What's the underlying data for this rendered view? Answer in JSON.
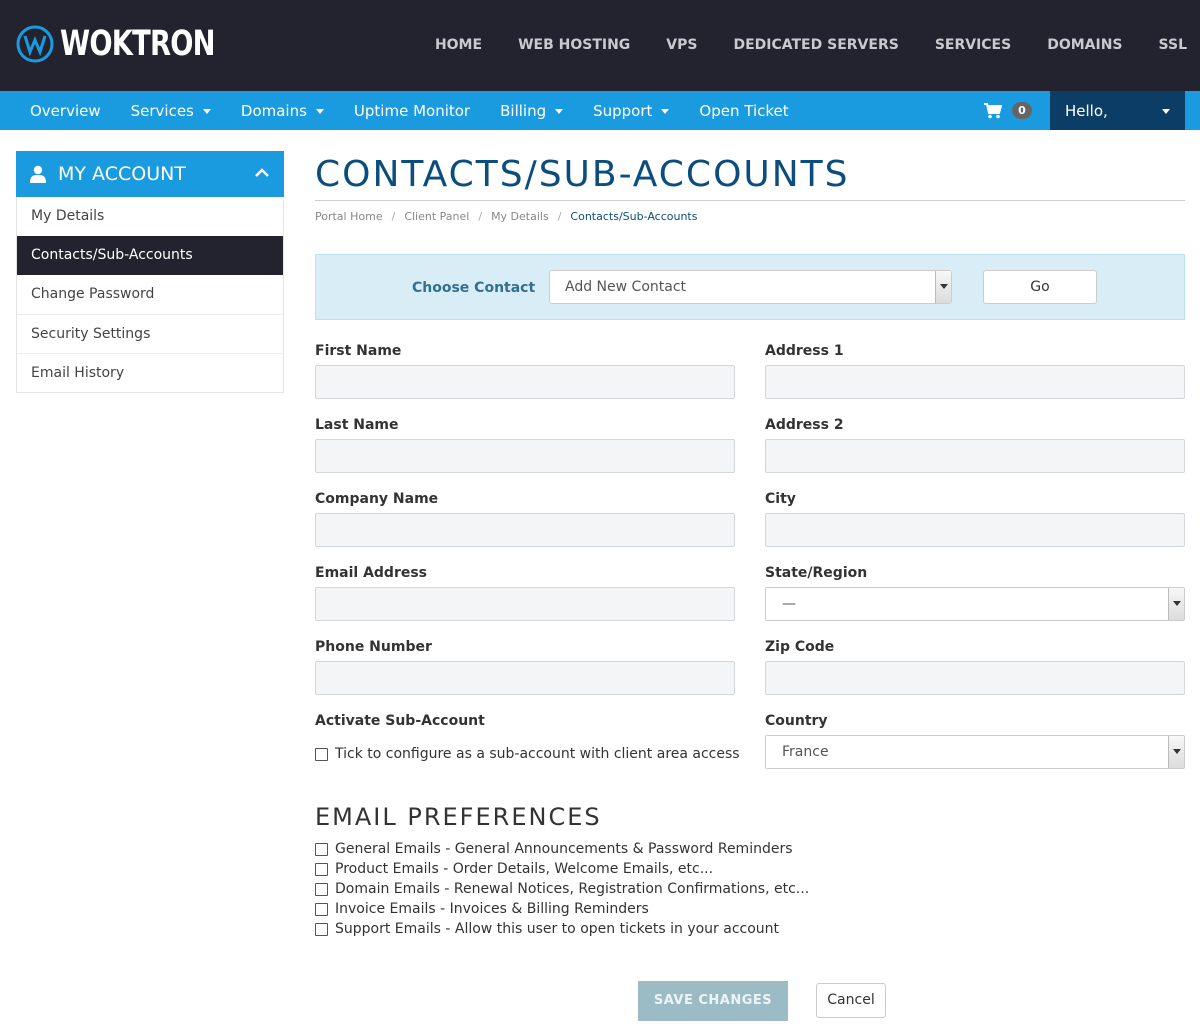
{
  "brand": {
    "name": "WOKTRON"
  },
  "top_nav": [
    "HOME",
    "WEB HOSTING",
    "VPS",
    "DEDICATED SERVERS",
    "SERVICES",
    "DOMAINS",
    "SSL"
  ],
  "sub_nav": {
    "items": [
      {
        "label": "Overview",
        "dropdown": false
      },
      {
        "label": "Services",
        "dropdown": true
      },
      {
        "label": "Domains",
        "dropdown": true
      },
      {
        "label": "Uptime Monitor",
        "dropdown": false
      },
      {
        "label": "Billing",
        "dropdown": true
      },
      {
        "label": "Support",
        "dropdown": true
      },
      {
        "label": "Open Ticket",
        "dropdown": false
      }
    ],
    "cart_count": "0",
    "user_greeting": "Hello,"
  },
  "sidebar": {
    "title": "MY ACCOUNT",
    "items": [
      "My Details",
      "Contacts/Sub-Accounts",
      "Change Password",
      "Security Settings",
      "Email History"
    ],
    "active_index": 1
  },
  "page": {
    "title": "CONTACTS/SUB-ACCOUNTS",
    "breadcrumb": [
      "Portal Home",
      "Client Panel",
      "My Details",
      "Contacts/Sub-Accounts"
    ]
  },
  "contact_chooser": {
    "label": "Choose Contact",
    "selected": "Add New Contact",
    "go_label": "Go"
  },
  "form": {
    "first_name": {
      "label": "First Name",
      "value": ""
    },
    "last_name": {
      "label": "Last Name",
      "value": ""
    },
    "company_name": {
      "label": "Company Name",
      "value": ""
    },
    "email": {
      "label": "Email Address",
      "value": ""
    },
    "phone": {
      "label": "Phone Number",
      "value": ""
    },
    "address1": {
      "label": "Address 1",
      "value": ""
    },
    "address2": {
      "label": "Address 2",
      "value": ""
    },
    "city": {
      "label": "City",
      "value": ""
    },
    "state": {
      "label": "State/Region",
      "value": "—"
    },
    "zip": {
      "label": "Zip Code",
      "value": ""
    },
    "country": {
      "label": "Country",
      "value": "France"
    },
    "subaccount": {
      "label": "Activate Sub-Account",
      "checkbox_text": "Tick to configure as a sub-account with client area access"
    }
  },
  "email_preferences": {
    "title": "EMAIL PREFERENCES",
    "items": [
      "General Emails - General Announcements & Password Reminders",
      "Product Emails - Order Details, Welcome Emails, etc...",
      "Domain Emails - Renewal Notices, Registration Confirmations, etc...",
      "Invoice Emails - Invoices & Billing Reminders",
      "Support Emails - Allow this user to open tickets in your account"
    ]
  },
  "actions": {
    "save_label": "SAVE CHANGES",
    "cancel_label": "Cancel"
  },
  "colors": {
    "header_bg": "#23232f",
    "accent_blue": "#1a9be0",
    "title_blue": "#0b4d7e",
    "user_menu_bg": "#0b3d66"
  }
}
